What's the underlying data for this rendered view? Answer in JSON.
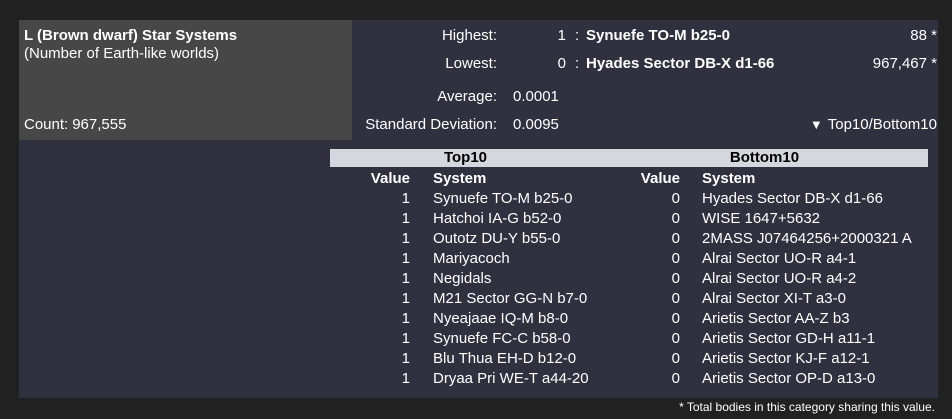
{
  "title": "L (Brown dwarf) Star Systems",
  "subtitle": "(Number of Earth-like worlds)",
  "count_label": "Count:",
  "count_value": "967,555",
  "stats": {
    "highest_label": "Highest:",
    "highest_value": "1",
    "highest_system": "Synuefe TO-M b25-0",
    "highest_total": "88 *",
    "lowest_label": "Lowest:",
    "lowest_value": "0",
    "lowest_system": "Hyades Sector DB-X d1-66",
    "lowest_total": "967,467 *",
    "average_label": "Average:",
    "average_value": "0.0001",
    "stddev_label": "Standard Deviation:",
    "stddev_value": "0.0095",
    "colon": ":"
  },
  "toggle_label": "Top10/Bottom10",
  "table": {
    "top10_header": "Top10",
    "bottom10_header": "Bottom10",
    "value_col": "Value",
    "system_col": "System",
    "top10": [
      {
        "value": "1",
        "system": "Synuefe TO-M b25-0"
      },
      {
        "value": "1",
        "system": "Hatchoi IA-G b52-0"
      },
      {
        "value": "1",
        "system": "Outotz DU-Y b55-0"
      },
      {
        "value": "1",
        "system": "Mariyacoch"
      },
      {
        "value": "1",
        "system": "Negidals"
      },
      {
        "value": "1",
        "system": "M21 Sector GG-N b7-0"
      },
      {
        "value": "1",
        "system": "Nyeajaae IQ-M b8-0"
      },
      {
        "value": "1",
        "system": "Synuefe FC-C b58-0"
      },
      {
        "value": "1",
        "system": "Blu Thua EH-D b12-0"
      },
      {
        "value": "1",
        "system": "Dryaa Pri WE-T a44-20"
      }
    ],
    "bottom10": [
      {
        "value": "0",
        "system": "Hyades Sector DB-X d1-66"
      },
      {
        "value": "0",
        "system": "WISE 1647+5632"
      },
      {
        "value": "0",
        "system": "2MASS J07464256+2000321 A"
      },
      {
        "value": "0",
        "system": "Alrai Sector UO-R a4-1"
      },
      {
        "value": "0",
        "system": "Alrai Sector UO-R a4-2"
      },
      {
        "value": "0",
        "system": "Alrai Sector XI-T a3-0"
      },
      {
        "value": "0",
        "system": "Arietis Sector AA-Z b3"
      },
      {
        "value": "0",
        "system": "Arietis Sector GD-H a11-1"
      },
      {
        "value": "0",
        "system": "Arietis Sector KJ-F a12-1"
      },
      {
        "value": "0",
        "system": "Arietis Sector OP-D a13-0"
      }
    ]
  },
  "footnote": "* Total bodies in this category sharing this value."
}
